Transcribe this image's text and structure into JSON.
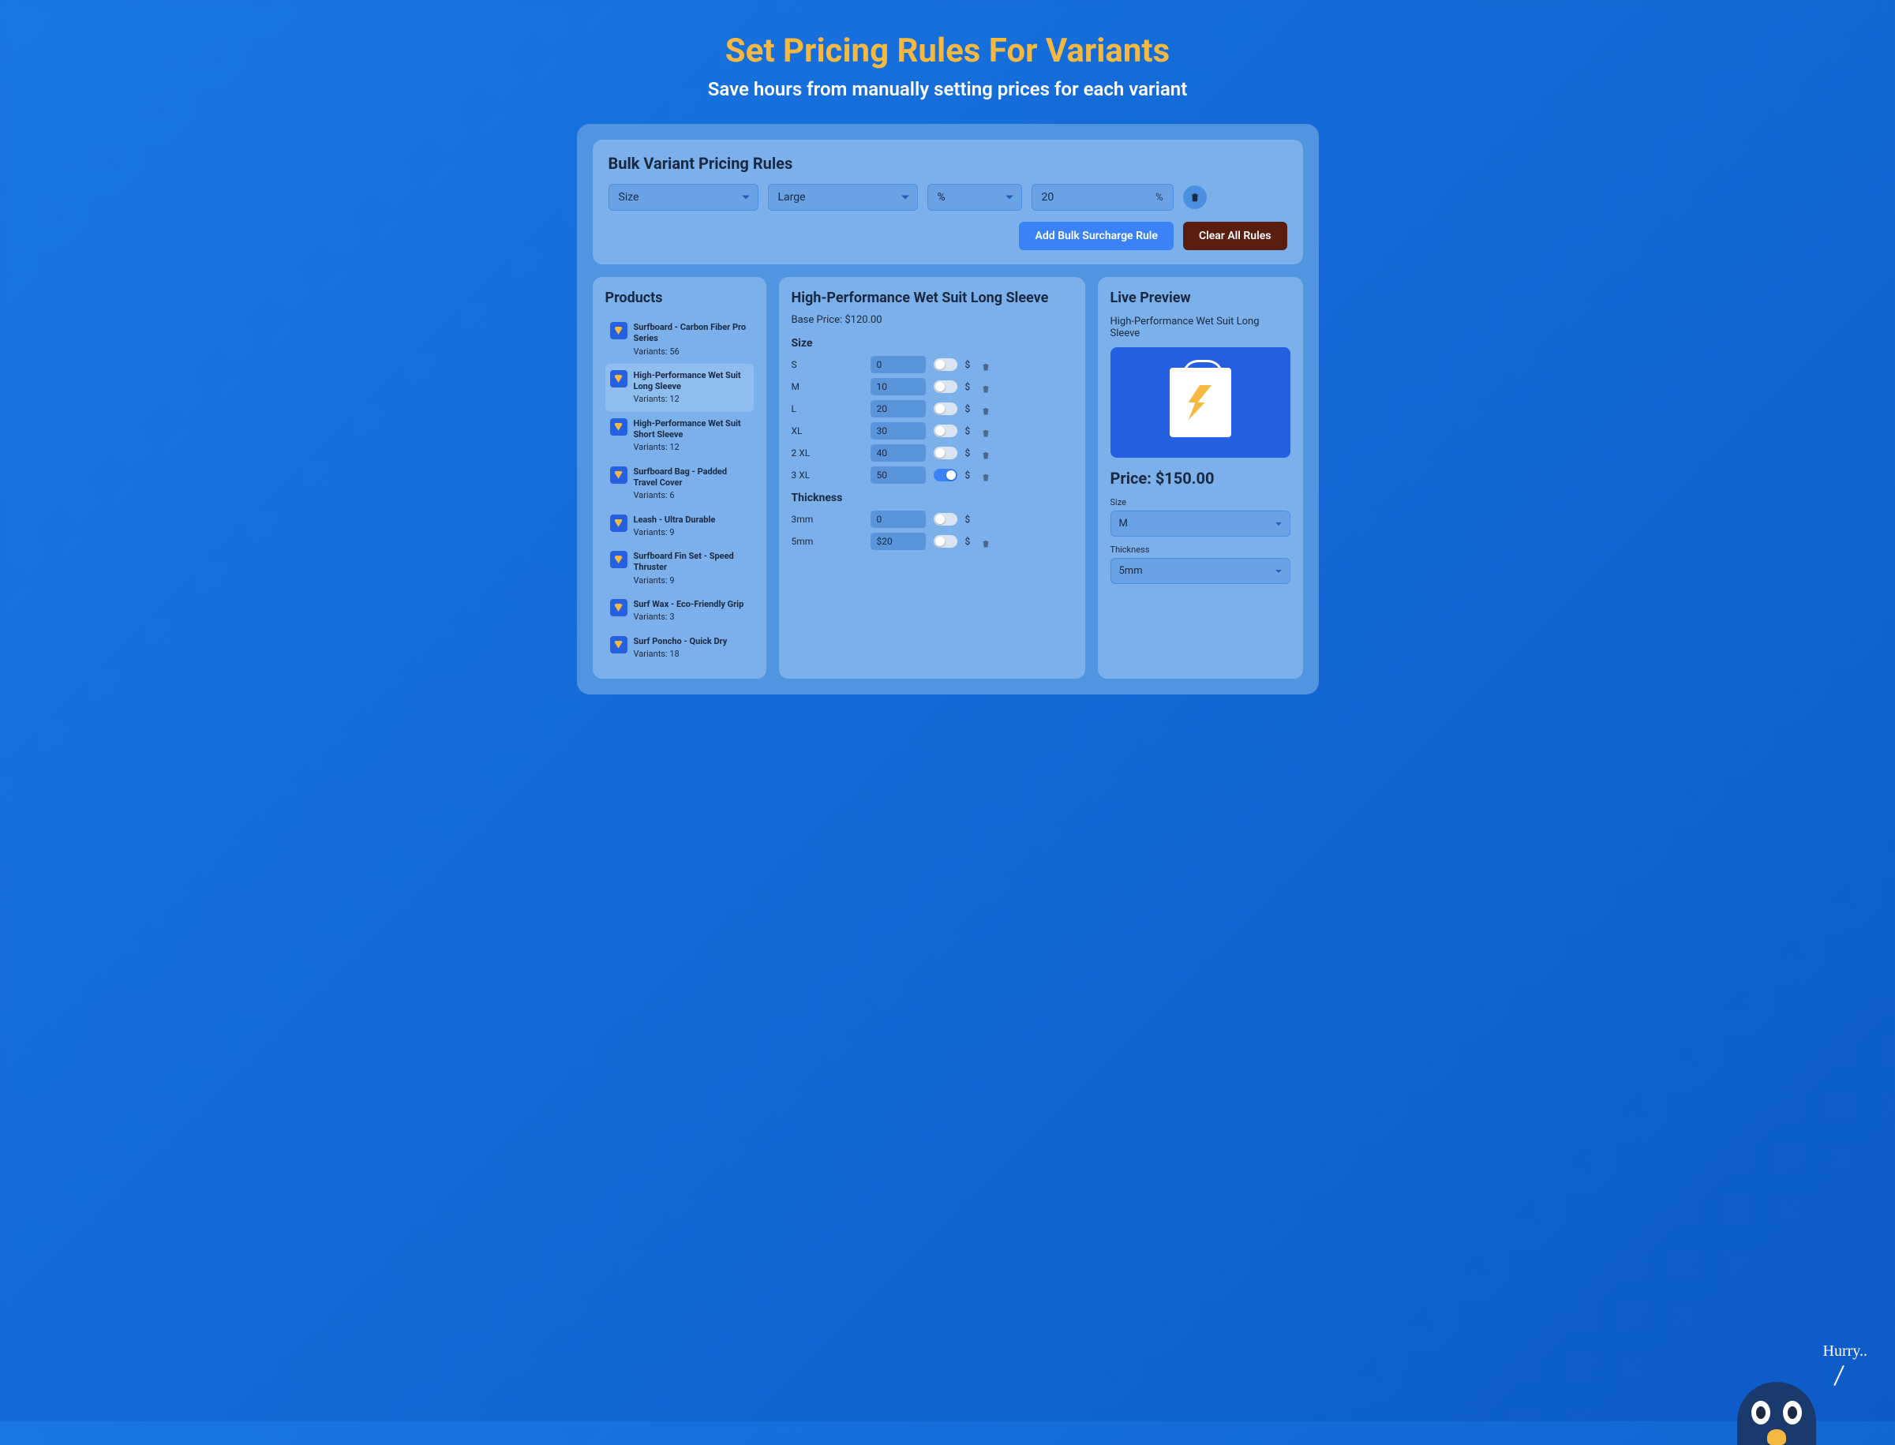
{
  "hero": {
    "title": "Set Pricing Rules For Variants",
    "subtitle": "Save hours from manually setting prices for each variant"
  },
  "rules": {
    "title": "Bulk Variant Pricing Rules",
    "attribute": "Size",
    "value": "Large",
    "type": "%",
    "amount": "20",
    "unit": "%",
    "add_btn": "Add Bulk Surcharge Rule",
    "clear_btn": "Clear All Rules"
  },
  "products": {
    "title": "Products",
    "items": [
      {
        "name": "Surfboard - Carbon Fiber Pro Series",
        "variants": "Variants: 56"
      },
      {
        "name": "High-Performance Wet Suit Long Sleeve",
        "variants": "Variants: 12"
      },
      {
        "name": "High-Performance Wet Suit Short Sleeve",
        "variants": "Variants: 12"
      },
      {
        "name": "Surfboard Bag - Padded Travel Cover",
        "variants": "Variants: 6"
      },
      {
        "name": "Leash - Ultra Durable",
        "variants": "Variants: 9"
      },
      {
        "name": "Surfboard Fin Set - Speed Thruster",
        "variants": "Variants: 9"
      },
      {
        "name": "Surf Wax - Eco-Friendly Grip",
        "variants": "Variants: 3"
      },
      {
        "name": "Surf Poncho - Quick Dry",
        "variants": "Variants: 18"
      }
    ]
  },
  "detail": {
    "title": "High-Performance Wet Suit Long Sleeve",
    "base_price": "Base Price: $120.00",
    "size_label": "Size",
    "thickness_label": "Thickness",
    "sizes": [
      {
        "name": "S",
        "value": "0",
        "unit": "$",
        "toggle": false,
        "trash": true
      },
      {
        "name": "M",
        "value": "10",
        "unit": "$",
        "toggle": false,
        "trash": true
      },
      {
        "name": "L",
        "value": "20",
        "unit": "$",
        "toggle": false,
        "trash": true
      },
      {
        "name": "XL",
        "value": "30",
        "unit": "$",
        "toggle": false,
        "trash": true
      },
      {
        "name": "2 XL",
        "value": "40",
        "unit": "$",
        "toggle": false,
        "trash": true
      },
      {
        "name": "3 XL",
        "value": "50",
        "unit": "$",
        "toggle": true,
        "trash": true
      }
    ],
    "thickness": [
      {
        "name": "3mm",
        "value": "0",
        "unit": "$",
        "toggle": false,
        "trash": false
      },
      {
        "name": "5mm",
        "value": "$20",
        "unit": "$",
        "toggle": false,
        "trash": true
      }
    ]
  },
  "preview": {
    "title": "Live Preview",
    "product": "High-Performance Wet Suit Long Sleeve",
    "price": "Price: $150.00",
    "size_label": "Size",
    "size_value": "M",
    "thickness_label": "Thickness",
    "thickness_value": "5mm"
  },
  "mascot": {
    "speech": "Hurry.."
  }
}
